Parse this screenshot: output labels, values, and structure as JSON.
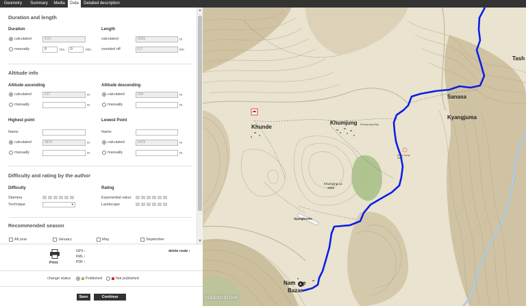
{
  "tabs": [
    "Geometry",
    "Summary",
    "Media",
    "Data",
    "Detailed description"
  ],
  "duration_length": {
    "title": "Duration and length",
    "duration": {
      "label": "Duration",
      "calculated_label": "calculated",
      "calculated_value": "4:21",
      "manually_label": "manually",
      "hours_value": "0",
      "hours_unit": "hrs.",
      "minutes_value": "0",
      "minutes_unit": "min."
    },
    "length": {
      "label": "Length",
      "calculated_label": "calculated",
      "calculated_value": "8383",
      "calculated_unit": "m",
      "rounded_label": "rounded off",
      "rounded_value": "8.2",
      "rounded_unit": "km"
    }
  },
  "altitude": {
    "title": "Altitude info",
    "ascending": {
      "label": "Altitude ascending",
      "calculated_label": "calculated",
      "calculated_value": "627",
      "manually_label": "manually",
      "unit": "m"
    },
    "descending": {
      "label": "Altitude descending",
      "calculated_label": "calculated",
      "calculated_value": "594",
      "manually_label": "manually",
      "unit": "m"
    },
    "highest": {
      "label": "Highest point",
      "name_label": "Name",
      "calculated_label": "calculated",
      "calculated_value": "3874",
      "manually_label": "manually",
      "unit": "m"
    },
    "lowest": {
      "label": "Lowest Point",
      "name_label": "Name",
      "calculated_label": "calculated",
      "calculated_value": "3429",
      "manually_label": "manually",
      "unit": "m"
    }
  },
  "difficulty": {
    "title": "Difficulty and rating by the author",
    "difficulty_label": "Difficulty",
    "stamina_label": "Stamina",
    "technique_label": "Technique",
    "technique_value": "",
    "rating_label": "Rating",
    "experiential_label": "Experiential value",
    "landscape_label": "Landscape"
  },
  "season": {
    "title": "Recommended season",
    "months": [
      "All year",
      "January",
      "May",
      "September"
    ]
  },
  "export": {
    "print_label": "Print",
    "links": [
      "GPX ›",
      "KML ›",
      "PDF ›"
    ],
    "delete_label": "delete route ›"
  },
  "status": {
    "label": "change status",
    "published": "Published",
    "not_published": "Not published",
    "published_color": "#8bc34a",
    "not_published_color": "#d32f2f"
  },
  "buttons": {
    "save": "Save",
    "continue": "Continue"
  },
  "map": {
    "places": [
      "Khunde",
      "Khumjung",
      "Sanasa",
      "Kyangjuma",
      "Tash",
      "Nam",
      "e",
      "Bazar",
      "Syangboche",
      "Khumjung La",
      "3868",
      "Khumjung Way",
      "Army Camp View"
    ],
    "attribution": "outdooractive",
    "route_color": "#0a1ee6"
  }
}
